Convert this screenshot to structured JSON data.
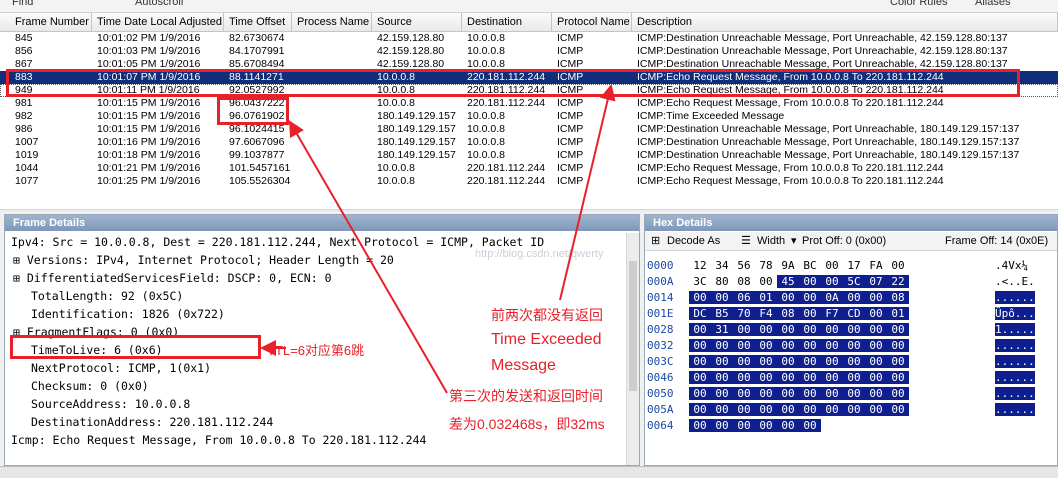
{
  "toolbar": {
    "find": "Find",
    "autoscroll": "Autoscroll",
    "color_rules": "Color Rules",
    "aliases": "Aliases"
  },
  "frame_list": {
    "columns": [
      "Frame Number",
      "Time Date Local Adjusted",
      "Time Offset",
      "Process Name",
      "Source",
      "Destination",
      "Protocol Name",
      "Description"
    ],
    "rows": [
      {
        "num": "845",
        "time": "10:01:02 PM 1/9/2016",
        "offset": "82.6730674",
        "proc": "",
        "src": "42.159.128.80",
        "dst": "10.0.0.8",
        "proto": "ICMP",
        "desc": "ICMP:Destination Unreachable Message, Port Unreachable, 42.159.128.80:137"
      },
      {
        "num": "856",
        "time": "10:01:03 PM 1/9/2016",
        "offset": "84.1707991",
        "proc": "",
        "src": "42.159.128.80",
        "dst": "10.0.0.8",
        "proto": "ICMP",
        "desc": "ICMP:Destination Unreachable Message, Port Unreachable, 42.159.128.80:137"
      },
      {
        "num": "867",
        "time": "10:01:05 PM 1/9/2016",
        "offset": "85.6708494",
        "proc": "",
        "src": "42.159.128.80",
        "dst": "10.0.0.8",
        "proto": "ICMP",
        "desc": "ICMP:Destination Unreachable Message, Port Unreachable, 42.159.128.80:137"
      },
      {
        "num": "883",
        "time": "10:01:07 PM 1/9/2016",
        "offset": "88.1141271",
        "proc": "",
        "src": "10.0.0.8",
        "dst": "220.181.112.244",
        "proto": "ICMP",
        "desc": "ICMP:Echo Request Message, From 10.0.0.8 To 220.181.112.244"
      },
      {
        "num": "949",
        "time": "10:01:11 PM 1/9/2016",
        "offset": "92.0527992",
        "proc": "",
        "src": "10.0.0.8",
        "dst": "220.181.112.244",
        "proto": "ICMP",
        "desc": "ICMP:Echo Request Message, From 10.0.0.8 To 220.181.112.244"
      },
      {
        "num": "981",
        "time": "10:01:15 PM 1/9/2016",
        "offset": "96.0437222",
        "proc": "",
        "src": "10.0.0.8",
        "dst": "220.181.112.244",
        "proto": "ICMP",
        "desc": "ICMP:Echo Request Message, From 10.0.0.8 To 220.181.112.244"
      },
      {
        "num": "982",
        "time": "10:01:15 PM 1/9/2016",
        "offset": "96.0761902",
        "proc": "",
        "src": "180.149.129.157",
        "dst": "10.0.0.8",
        "proto": "ICMP",
        "desc": "ICMP:Time Exceeded Message"
      },
      {
        "num": "986",
        "time": "10:01:15 PM 1/9/2016",
        "offset": "96.1024415",
        "proc": "",
        "src": "180.149.129.157",
        "dst": "10.0.0.8",
        "proto": "ICMP",
        "desc": "ICMP:Destination Unreachable Message, Port Unreachable, 180.149.129.157:137"
      },
      {
        "num": "1007",
        "time": "10:01:16 PM 1/9/2016",
        "offset": "97.6067096",
        "proc": "",
        "src": "180.149.129.157",
        "dst": "10.0.0.8",
        "proto": "ICMP",
        "desc": "ICMP:Destination Unreachable Message, Port Unreachable, 180.149.129.157:137"
      },
      {
        "num": "1019",
        "time": "10:01:18 PM 1/9/2016",
        "offset": "99.1037877",
        "proc": "",
        "src": "180.149.129.157",
        "dst": "10.0.0.8",
        "proto": "ICMP",
        "desc": "ICMP:Destination Unreachable Message, Port Unreachable, 180.149.129.157:137"
      },
      {
        "num": "1044",
        "time": "10:01:21 PM 1/9/2016",
        "offset": "101.5457161",
        "proc": "",
        "src": "10.0.0.8",
        "dst": "220.181.112.244",
        "proto": "ICMP",
        "desc": "ICMP:Echo Request Message, From 10.0.0.8 To 220.181.112.244"
      },
      {
        "num": "1077",
        "time": "10:01:25 PM 1/9/2016",
        "offset": "105.5526304",
        "proc": "",
        "src": "10.0.0.8",
        "dst": "220.181.112.244",
        "proto": "ICMP",
        "desc": "ICMP:Echo Request Message, From 10.0.0.8 To 220.181.112.244"
      }
    ]
  },
  "frame_details": {
    "title": "Frame Details",
    "lines": [
      "Ipv4: Src = 10.0.0.8, Dest = 220.181.112.244, Next Protocol = ICMP, Packet ID",
      "Versions: IPv4, Internet Protocol; Header Length = 20",
      "DifferentiatedServicesField: DSCP: 0, ECN: 0",
      "TotalLength: 92 (0x5C)",
      "Identification: 1826 (0x722)",
      "FragmentFlags: 0 (0x0)",
      "TimeToLive: 6 (0x6)",
      "NextProtocol: ICMP, 1(0x1)",
      "Checksum: 0 (0x0)",
      "SourceAddress: 10.0.0.8",
      "DestinationAddress: 220.181.112.244",
      "Icmp: Echo Request Message, From 10.0.0.8 To 220.181.112.244"
    ]
  },
  "hex_details": {
    "title": "Hex Details",
    "decode_as": "Decode As",
    "width": "Width",
    "prot_off": "Prot Off: 0 (0x00)",
    "frame_off": "Frame Off: 14 (0x0E)",
    "offsets": [
      "0000",
      "000A",
      "0014",
      "001E",
      "0028",
      "0032",
      "003C",
      "0046",
      "0050",
      "005A",
      "0064"
    ],
    "rows": [
      [
        "12",
        "34",
        "56",
        "78",
        "9A",
        "BC",
        "00",
        "17",
        "FA",
        "00"
      ],
      [
        "3C",
        "80",
        "08",
        "00",
        "45",
        "00",
        "00",
        "5C",
        "07",
        "22"
      ],
      [
        "00",
        "00",
        "06",
        "01",
        "00",
        "00",
        "0A",
        "00",
        "00",
        "08"
      ],
      [
        "DC",
        "B5",
        "70",
        "F4",
        "08",
        "00",
        "F7",
        "CD",
        "00",
        "01"
      ],
      [
        "00",
        "31",
        "00",
        "00",
        "00",
        "00",
        "00",
        "00",
        "00",
        "00"
      ],
      [
        "00",
        "00",
        "00",
        "00",
        "00",
        "00",
        "00",
        "00",
        "00",
        "00"
      ],
      [
        "00",
        "00",
        "00",
        "00",
        "00",
        "00",
        "00",
        "00",
        "00",
        "00"
      ],
      [
        "00",
        "00",
        "00",
        "00",
        "00",
        "00",
        "00",
        "00",
        "00",
        "00"
      ],
      [
        "00",
        "00",
        "00",
        "00",
        "00",
        "00",
        "00",
        "00",
        "00",
        "00"
      ],
      [
        "00",
        "00",
        "00",
        "00",
        "00",
        "00",
        "00",
        "00",
        "00",
        "00"
      ],
      [
        "00",
        "00",
        "00",
        "00",
        "00",
        "00",
        "",
        "",
        "",
        ""
      ]
    ],
    "ascii": [
      ".4Vx¼",
      ".<..E.",
      "......",
      "Üpô...",
      "1.....",
      "......",
      "......",
      "......",
      "......",
      "......",
      ""
    ]
  },
  "annotations": {
    "ttl": "TTL=6对应第6跳",
    "no_return_1": "前两次都没有返回",
    "no_return_2": "Time Exceeded",
    "no_return_3": "Message",
    "third_1": "第三次的发送和返回时间",
    "third_2": "差为0.032468s，即32ms"
  },
  "watermark": "http://blog.csdn.net/qwerty"
}
